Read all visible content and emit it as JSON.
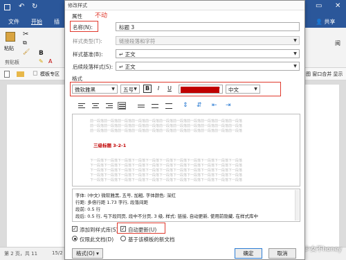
{
  "ribbon": {
    "file_tab": "文件",
    "home_tab": "开始",
    "insert_tab": "插",
    "share_button": "共享",
    "paste_label": "粘贴",
    "clipboard_label": "剪贴板",
    "template_zone": "模板专区",
    "right_partial": "图 窗口合并 显示",
    "extra_label": "阅"
  },
  "dialog": {
    "title": "修改样式",
    "annotation": "不动",
    "properties_header": "属性",
    "name_label": "名称(N):",
    "name_value": "标题 3",
    "style_type_label": "样式类型(T):",
    "style_type_value": "链接段落和字符",
    "based_on_label": "样式基准(B):",
    "based_on_value": "↵ 正文",
    "following_label": "后续段落样式(S):",
    "following_value": "↵ 正文",
    "format_header": "格式",
    "font_name": "微软雅黑",
    "font_size": "五号",
    "bold": "B",
    "italic": "I",
    "underline": "U",
    "script": "中文",
    "preview_line": "前一段落前一段落前一段落前一段落前一段落前一段落前一段落前一段落前一段落前一段落前一段落",
    "preview_heading": "三级标题 3-2-1",
    "preview_after": "下一段落下一段落下一段落下一段落下一段落下一段落下一段落下一段落下一段落下一段落下一段落",
    "description": [
      "字体: (中文) 微软雅黑, 五号, 加粗, 字体颜色: 深红",
      "    行距: 多倍行距 1.73 字行, 段落间距",
      "    段前: 0.5 行",
      "    段后: 0.5 行, 与下段同页, 段中不分页, 3 级, 样式: 链接, 自动更新, 使用前隐藏, 在样式库中"
    ],
    "add_to_gallery": "添加到样式库(S)",
    "auto_update": "自动更新(U)",
    "only_this_doc": "仅限此文档(D)",
    "new_docs_template": "基于该模板的新文档",
    "format_button": "格式(O) ▾",
    "ok_button": "确定",
    "cancel_button": "取消"
  },
  "status": {
    "page": "第 2 页，共 11",
    "page_partial": "15/2",
    "watermark": "CSDN @甜心少女不honey"
  },
  "colors": {
    "word_blue": "#2b579a",
    "annotation_red": "#e0392d",
    "font_color": "#c00000"
  }
}
